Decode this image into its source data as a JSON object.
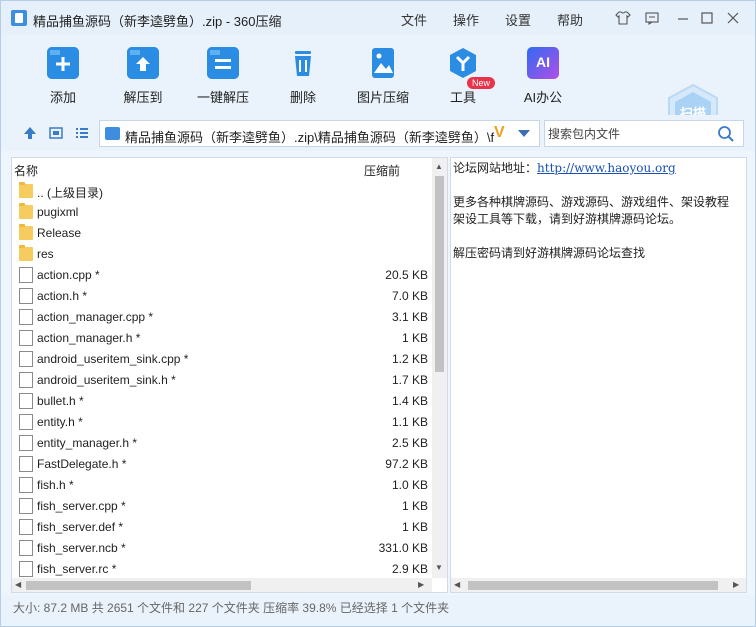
{
  "window": {
    "title": "精品捕鱼源码（新李逵劈鱼）.zip - 360压缩",
    "menu": [
      "文件",
      "操作",
      "设置",
      "帮助"
    ]
  },
  "toolbar": {
    "items": [
      {
        "label": "添加",
        "icon": "add-icon"
      },
      {
        "label": "解压到",
        "icon": "extract-to-icon"
      },
      {
        "label": "一键解压",
        "icon": "one-click-extract-icon"
      },
      {
        "label": "删除",
        "icon": "delete-icon"
      },
      {
        "label": "图片压缩",
        "icon": "image-compress-icon"
      },
      {
        "label": "工具",
        "icon": "tools-icon"
      },
      {
        "label": "AI办公",
        "icon": "ai-office-icon"
      }
    ],
    "new_badge": "New",
    "ai_icon_text": "AI",
    "scan_label": "扫描"
  },
  "address": {
    "path": "精品捕鱼源码（新李逵劈鱼）.zip\\精品捕鱼源码（新李逵劈鱼）\\fish_",
    "search_placeholder": "搜索包内文件"
  },
  "filelist": {
    "col_name": "名称",
    "col_size": "压缩前",
    "rows": [
      {
        "name": ".. (上级目录)",
        "size": "",
        "type": "folder"
      },
      {
        "name": "pugixml",
        "size": "",
        "type": "folder"
      },
      {
        "name": "Release",
        "size": "",
        "type": "folder"
      },
      {
        "name": "res",
        "size": "",
        "type": "folder"
      },
      {
        "name": "action.cpp *",
        "size": "20.5 KB",
        "type": "file"
      },
      {
        "name": "action.h *",
        "size": "7.0 KB",
        "type": "file"
      },
      {
        "name": "action_manager.cpp *",
        "size": "3.1 KB",
        "type": "file"
      },
      {
        "name": "action_manager.h *",
        "size": "1 KB",
        "type": "file"
      },
      {
        "name": "android_useritem_sink.cpp *",
        "size": "1.2 KB",
        "type": "file"
      },
      {
        "name": "android_useritem_sink.h *",
        "size": "1.7 KB",
        "type": "file"
      },
      {
        "name": "bullet.h *",
        "size": "1.4 KB",
        "type": "file"
      },
      {
        "name": "entity.h *",
        "size": "1.1 KB",
        "type": "file"
      },
      {
        "name": "entity_manager.h *",
        "size": "2.5 KB",
        "type": "file"
      },
      {
        "name": "FastDelegate.h *",
        "size": "97.2 KB",
        "type": "file"
      },
      {
        "name": "fish.h *",
        "size": "1.0 KB",
        "type": "file"
      },
      {
        "name": "fish_server.cpp *",
        "size": "1 KB",
        "type": "file"
      },
      {
        "name": "fish_server.def *",
        "size": "1 KB",
        "type": "file"
      },
      {
        "name": "fish_server.ncb *",
        "size": "331.0 KB",
        "type": "file"
      },
      {
        "name": "fish_server.rc *",
        "size": "2.9 KB",
        "type": "file"
      }
    ]
  },
  "comment": {
    "line1_label": "论坛网站地址：",
    "line1_link": "http://www.haoyou.org",
    "line2": "更多各种棋牌源码、游戏源码、游戏组件、架设教程",
    "line3": "架设工具等下载，请到好游棋牌源码论坛。",
    "line4": "解压密码请到好游棋牌源码论坛查找"
  },
  "status": {
    "text": "大小: 87.2 MB 共 2651 个文件和 227 个文件夹 压缩率 39.8% 已经选择 1 个文件夹"
  }
}
